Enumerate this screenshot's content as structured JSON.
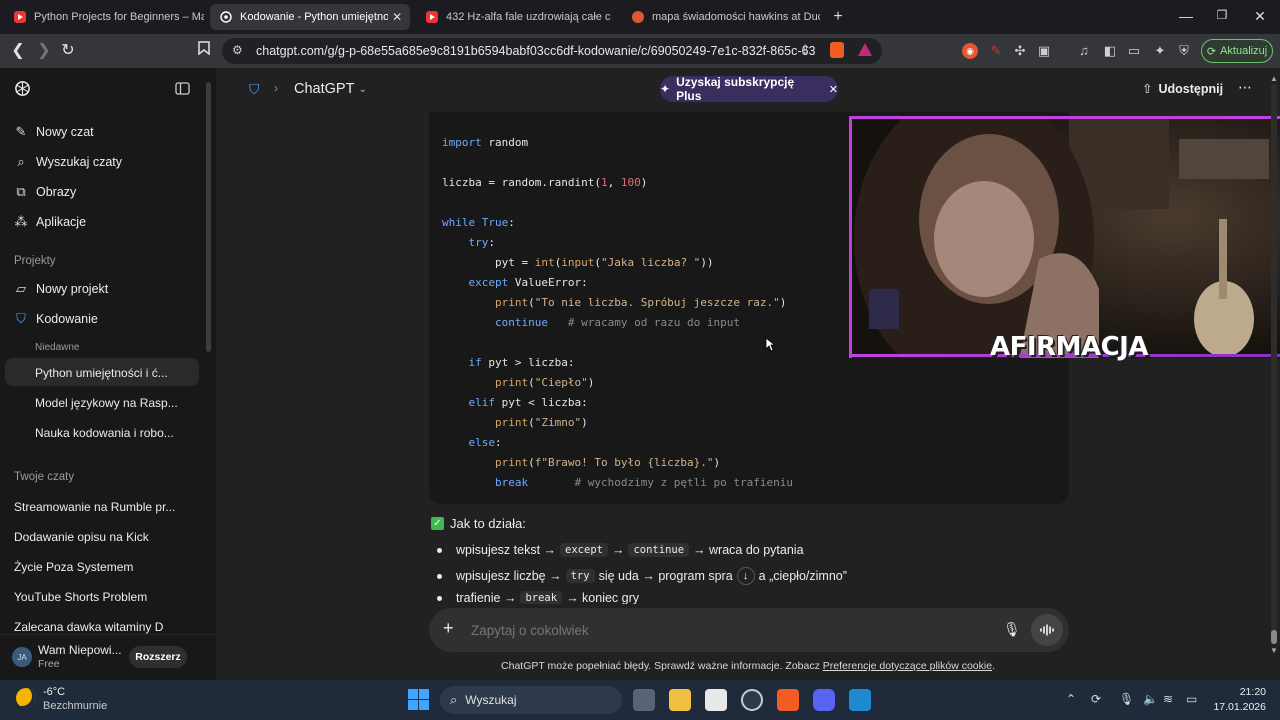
{
  "browser": {
    "tabs": [
      {
        "title": "Python Projects for Beginners – Mast",
        "icon": "youtube-icon",
        "active": false
      },
      {
        "title": "Kodowanie - Python umiejętność",
        "icon": "chatgpt-icon",
        "active": true
      },
      {
        "title": "432 Hz-alfa fale uzdrowiają całe c",
        "icon": "youtube-icon",
        "active": false
      },
      {
        "title": "mapa świadomości hawkins at Duck",
        "icon": "duckduckgo-icon",
        "active": false
      }
    ],
    "url": "chatgpt.com/g/g-p-68e55a685e9c8191b6594babf03cc6df-kodowanie/c/69050249-7e1c-832f-865c-63...",
    "update_label": "Aktualizuj"
  },
  "sidebar": {
    "nav": [
      {
        "label": "Nowy czat",
        "icon": "new-chat-icon"
      },
      {
        "label": "Wyszukaj czaty",
        "icon": "search-icon"
      },
      {
        "label": "Obrazy",
        "icon": "images-icon"
      },
      {
        "label": "Aplikacje",
        "icon": "apps-icon"
      }
    ],
    "projects_heading": "Projekty",
    "projects": [
      {
        "label": "Nowy projekt",
        "icon": "folder-plus-icon"
      },
      {
        "label": "Kodowanie",
        "icon": "graduation-cap-icon"
      }
    ],
    "recent_heading": "Niedawne",
    "recent": [
      "Python umiejętności i ć...",
      "Model językowy na Rasp...",
      "Nauka kodowania i robo..."
    ],
    "chats_heading": "Twoje czaty",
    "chats": [
      "Streamowanie na Rumble pr...",
      "Dodawanie opisu na Kick",
      "Życie Poza Systemem",
      "YouTube Shorts Problem",
      "Zalecana dawka witaminy D"
    ],
    "user": {
      "initials": "JA",
      "name": "Wam Niepowi...",
      "plan": "Free",
      "upgrade_label": "Rozszerz"
    }
  },
  "header": {
    "breadcrumb_title": "ChatGPT",
    "plus_banner": "Uzyskaj subskrypcję Plus",
    "share_label": "Udostępnij"
  },
  "code": {
    "lines": [
      "import random",
      "",
      "liczba = random.randint(1, 100)",
      "",
      "while True:",
      "    try:",
      "        pyt = int(input(\"Jaka liczba? \"))",
      "    except ValueError:",
      "        print(\"To nie liczba. Spróbuj jeszcze raz.\")",
      "        continue   # wracamy od razu do input",
      "",
      "    if pyt > liczba:",
      "        print(\"Ciepło\")",
      "    elif pyt < liczba:",
      "        print(\"Zimno\")",
      "    else:",
      "        print(f\"Brawo! To było {liczba}.\")",
      "        break       # wychodzimy z pętli po trafieniu"
    ]
  },
  "overlay": {
    "caption": "AFIRMACJA"
  },
  "response": {
    "heading": "Jak to działa:",
    "bullets": [
      {
        "parts": [
          "wpisujesz tekst →",
          "except",
          "→",
          "continue",
          "→ wraca do pytania"
        ],
        "code_idx": [
          1,
          3
        ]
      },
      {
        "parts": [
          "wpisujesz liczbę →",
          "try",
          "się uda → program spra",
          "a „ciepło/zimno”"
        ],
        "code_idx": [
          1
        ]
      },
      {
        "parts": [
          "trafienie →",
          "break",
          "→ koniec gry"
        ],
        "code_idx": [
          1
        ]
      }
    ]
  },
  "composer": {
    "placeholder": "Zapytaj o cokolwiek"
  },
  "disclaimer": {
    "text": "ChatGPT może popełniać błędy. Sprawdź ważne informacje. Zobacz",
    "link": "Preferencje dotyczące plików cookie",
    "suffix": "."
  },
  "taskbar": {
    "weather_temp": "-6°C",
    "weather_desc": "Bezchmurnie",
    "search_label": "Wyszukaj",
    "time": "21:20",
    "date": "17.01.2026"
  },
  "colors": {
    "accent_purple": "#c040e0",
    "plus_banner_bg": "#3a2e5e",
    "keyword_blue": "#6fa8ff",
    "string_tan": "#d4b48a"
  }
}
